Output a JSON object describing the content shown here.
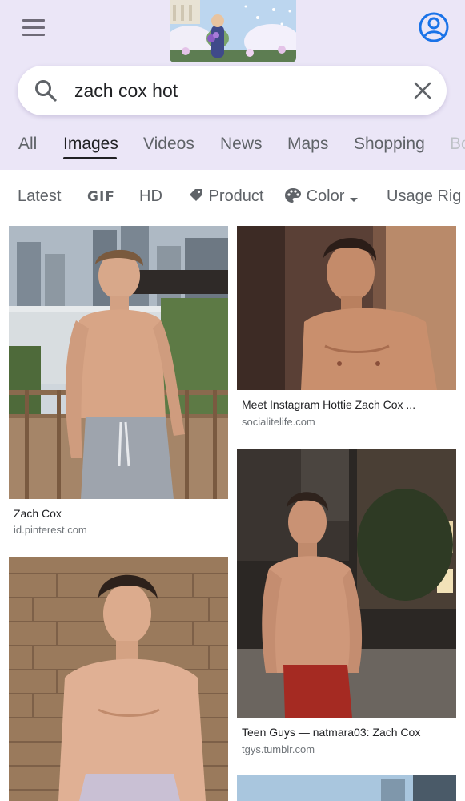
{
  "search": {
    "query": "zach cox hot"
  },
  "tabs": [
    {
      "label": "All"
    },
    {
      "label": "Images"
    },
    {
      "label": "Videos"
    },
    {
      "label": "News"
    },
    {
      "label": "Maps"
    },
    {
      "label": "Shopping"
    },
    {
      "label": "Bo"
    }
  ],
  "active_tab": "Images",
  "filters": [
    {
      "label": "Latest"
    },
    {
      "label": "GIF"
    },
    {
      "label": "HD"
    },
    {
      "label": "Product"
    },
    {
      "label": "Color"
    },
    {
      "label": "Usage Rig"
    }
  ],
  "results": [
    {
      "title": "Zach Cox",
      "source": "id.pinterest.com"
    },
    {
      "title": "Meet Instagram Hottie Zach Cox ...",
      "source": "socialitelife.com"
    },
    {
      "title": "Teen Guys — natmara03: Zach Cox",
      "source": "tgys.tumblr.com"
    }
  ],
  "colors": {
    "header_bg": "#ebe6f7",
    "accent_blue": "#1a73e8",
    "text_secondary": "#5f6368"
  }
}
